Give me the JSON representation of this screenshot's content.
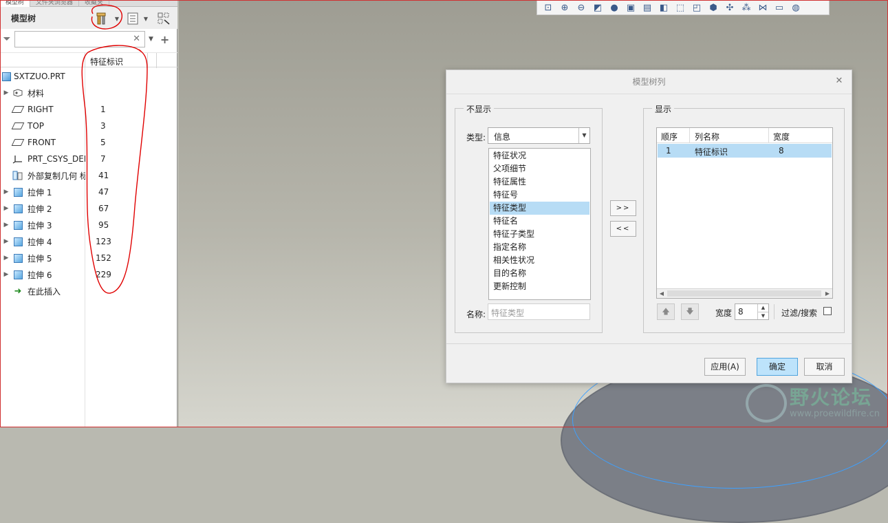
{
  "panel_tabs": [
    "模型树",
    "文件夹浏览器",
    "收藏夹"
  ],
  "tree": {
    "title": "模型树",
    "column_header": "特征标识",
    "root": "SXTZUO.PRT",
    "rows": [
      {
        "label": "材料",
        "id": "",
        "expandable": true,
        "icon": "material-icon"
      },
      {
        "label": "RIGHT",
        "id": "1",
        "expandable": false,
        "icon": "datum-plane-icon"
      },
      {
        "label": "TOP",
        "id": "3",
        "expandable": false,
        "icon": "datum-plane-icon"
      },
      {
        "label": "FRONT",
        "id": "5",
        "expandable": false,
        "icon": "datum-plane-icon"
      },
      {
        "label": "PRT_CSYS_DEF",
        "id": "7",
        "expandable": false,
        "icon": "csys-icon"
      },
      {
        "label": "外部复制几何 标",
        "id": "41",
        "expandable": false,
        "icon": "copy-geom-icon"
      },
      {
        "label": "拉伸 1",
        "id": "47",
        "expandable": true,
        "icon": "extrude-icon"
      },
      {
        "label": "拉伸 2",
        "id": "67",
        "expandable": true,
        "icon": "extrude-icon"
      },
      {
        "label": "拉伸 3",
        "id": "95",
        "expandable": true,
        "icon": "extrude-icon"
      },
      {
        "label": "拉伸 4",
        "id": "123",
        "expandable": true,
        "icon": "extrude-icon"
      },
      {
        "label": "拉伸 5",
        "id": "152",
        "expandable": true,
        "icon": "extrude-icon"
      },
      {
        "label": "拉伸 6",
        "id": "229",
        "expandable": true,
        "icon": "extrude-icon"
      },
      {
        "label": "在此插入",
        "id": "",
        "expandable": false,
        "icon": "insert-arrow-icon"
      }
    ]
  },
  "dialog": {
    "title": "模型树列",
    "hidden_group": "不显示",
    "shown_group": "显示",
    "type_label": "类型:",
    "type_value": "信息",
    "list_items": [
      "特征状况",
      "父项细节",
      "特征属性",
      "特征号",
      "特征类型",
      "特征名",
      "特征子类型",
      "指定名称",
      "相关性状况",
      "目的名称",
      "更新控制"
    ],
    "selected_item": "特征类型",
    "name_label": "名称:",
    "name_placeholder": "特征类型",
    "add_button": ">>",
    "remove_button": "<<",
    "grid_headers": [
      "顺序",
      "列名称",
      "宽度"
    ],
    "grid_row": {
      "order": "1",
      "name": "特征标识",
      "width": "8"
    },
    "width_label": "宽度",
    "width_value": "8",
    "filter_label": "过滤/搜索",
    "apply": "应用(A)",
    "ok": "确定",
    "cancel": "取消"
  },
  "watermark": {
    "title": "野火论坛",
    "url": "www.proewildfire.cn"
  },
  "colors": {
    "selection": "#b7dcf5",
    "annotation": "#e00000"
  }
}
